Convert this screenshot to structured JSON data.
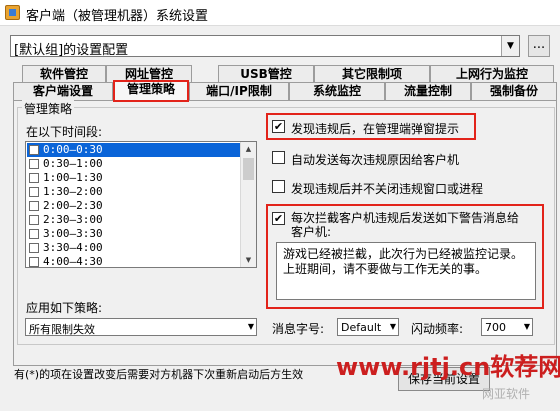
{
  "window": {
    "title": "客户端（被管理机器）系统设置"
  },
  "group_select": {
    "value": "[默认组]的设置配置",
    "more_label": "..."
  },
  "tabs_row1": [
    "软件管控",
    "网址管控",
    "USB管控",
    "其它限制项",
    "上网行为监控"
  ],
  "tabs_row2": [
    "客户端设置",
    "管理策略",
    "端口/IP限制",
    "系统监控",
    "流量控制",
    "强制备份"
  ],
  "active_tab": "管理策略",
  "policy_group": {
    "title": "管理策略",
    "time_label": "在以下时间段:",
    "time_slots": [
      "0:00—0:30",
      "0:30—1:00",
      "1:00—1:30",
      "1:30—2:00",
      "2:00—2:30",
      "2:30—3:00",
      "3:00—3:30",
      "3:30—4:00",
      "4:00—4:30"
    ],
    "selected_slot": "0:00—0:30",
    "apply_label": "应用如下策略:",
    "apply_value": "所有限制失效"
  },
  "options": {
    "popup": {
      "label": "发现违规后，在管理端弹窗提示",
      "checked": true,
      "check_glyph": "✔"
    },
    "send_reason": {
      "label": "自动发送每次违规原因给客户机",
      "checked": false
    },
    "no_close": {
      "label": "发现违规后并不关闭违规窗口或进程",
      "checked": false
    },
    "send_warning": {
      "label_line1": "每次拦截客户机违规后发送如下警告消息给",
      "label_line2": "客户机:",
      "checked": true,
      "check_glyph": "✔"
    }
  },
  "message": {
    "line1": "游戏已经被拦截，此次行为已经被监控记录。",
    "line2": "上班期间，请不要做与工作无关的事。"
  },
  "font_size": {
    "label": "消息字号:",
    "value": "Default"
  },
  "flash_rate": {
    "label": "闪动频率:",
    "value": "700"
  },
  "footer_note": "有(*)的项在设置改变后需要对方机器下次重新启动后方生效",
  "save_button": "保存当前设置",
  "watermark": {
    "site": "www.rjtj.cn软荐网",
    "sub": "网亚软件"
  },
  "colors": {
    "highlight": "#e2231a",
    "selection": "#0a64d8"
  }
}
